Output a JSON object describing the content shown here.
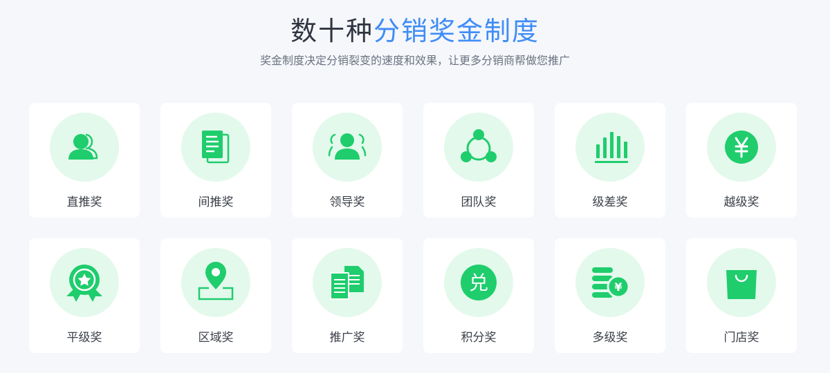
{
  "header": {
    "title_dark": "数十种",
    "title_accent": "分销奖金制度",
    "subtitle": "奖金制度决定分销裂变的速度和效果，让更多分销商帮做您推广"
  },
  "colors": {
    "accent": "#3f8cf6",
    "icon_green": "#1fcd6d",
    "icon_bg": "#e3f9ec"
  },
  "cards": [
    {
      "label": "直推奖",
      "icon": "users-icon"
    },
    {
      "label": "间推奖",
      "icon": "document-icon"
    },
    {
      "label": "领导奖",
      "icon": "leader-icon"
    },
    {
      "label": "团队奖",
      "icon": "team-network-icon"
    },
    {
      "label": "级差奖",
      "icon": "bar-chart-icon"
    },
    {
      "label": "越级奖",
      "icon": "yen-coin-icon"
    },
    {
      "label": "平级奖",
      "icon": "award-badge-icon"
    },
    {
      "label": "区域奖",
      "icon": "location-pin-icon"
    },
    {
      "label": "推广奖",
      "icon": "files-icon"
    },
    {
      "label": "积分奖",
      "icon": "exchange-icon",
      "glyph": "兑"
    },
    {
      "label": "多级奖",
      "icon": "coins-stack-icon",
      "glyph": "¥"
    },
    {
      "label": "门店奖",
      "icon": "shopping-bag-icon"
    }
  ]
}
